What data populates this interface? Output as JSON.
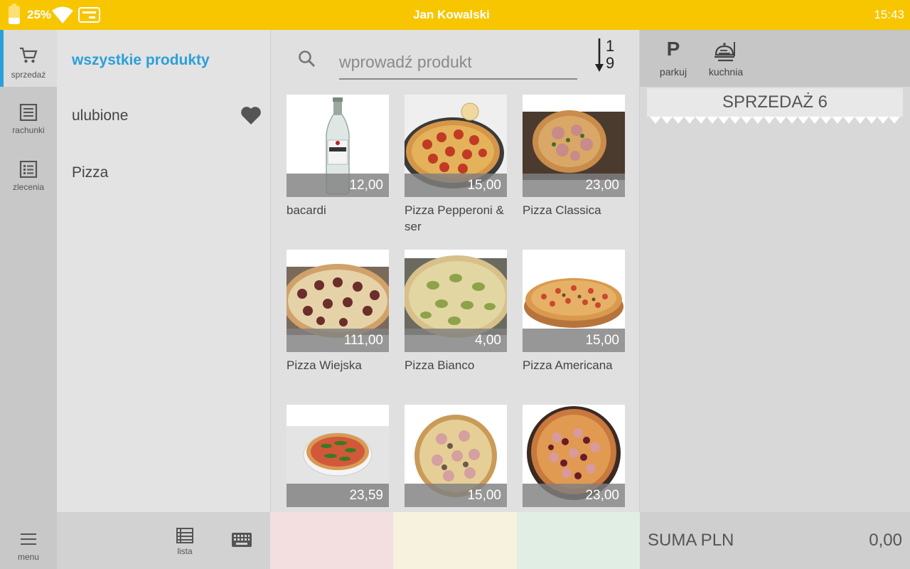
{
  "status_bar": {
    "battery_percent": "25%",
    "user_name": "Jan Kowalski",
    "time": "15:43"
  },
  "nav_rail": {
    "items": [
      {
        "label": "sprzedaż",
        "icon": "cart-icon"
      },
      {
        "label": "rachunki",
        "icon": "receipt-icon"
      },
      {
        "label": "zlecenia",
        "icon": "checklist-icon"
      }
    ],
    "menu_label": "menu"
  },
  "categories": {
    "items": [
      {
        "label": "wszystkie produkty"
      },
      {
        "label": "ulubione"
      },
      {
        "label": "Pizza"
      }
    ],
    "list_label": "lista"
  },
  "search": {
    "placeholder": "wprowadź produkt"
  },
  "sort": {
    "top": "1",
    "bottom": "9"
  },
  "products": [
    {
      "name": "bacardi",
      "price": "12,00"
    },
    {
      "name": "Pizza Pepperoni & ser",
      "price": "15,00"
    },
    {
      "name": "Pizza Classica",
      "price": "23,00"
    },
    {
      "name": "Pizza Wiejska",
      "price": "111,00"
    },
    {
      "name": "Pizza Bianco",
      "price": "4,00"
    },
    {
      "name": "Pizza Americana",
      "price": "15,00"
    },
    {
      "name": "",
      "price": "23,59"
    },
    {
      "name": "",
      "price": "15,00"
    },
    {
      "name": "",
      "price": "23,00"
    }
  ],
  "color_slots": [
    "#f4dfe0",
    "#f7f2de",
    "#e1eee4"
  ],
  "order": {
    "title": "SPRZEDAŻ 6",
    "park_label": "parkuj",
    "park_symbol": "P",
    "kitchen_label": "kuchnia",
    "sum_label": "SUMA PLN",
    "sum_value": "0,00"
  },
  "colors": {
    "accent": "#2b9fd9",
    "status_bar": "#f7c600"
  }
}
